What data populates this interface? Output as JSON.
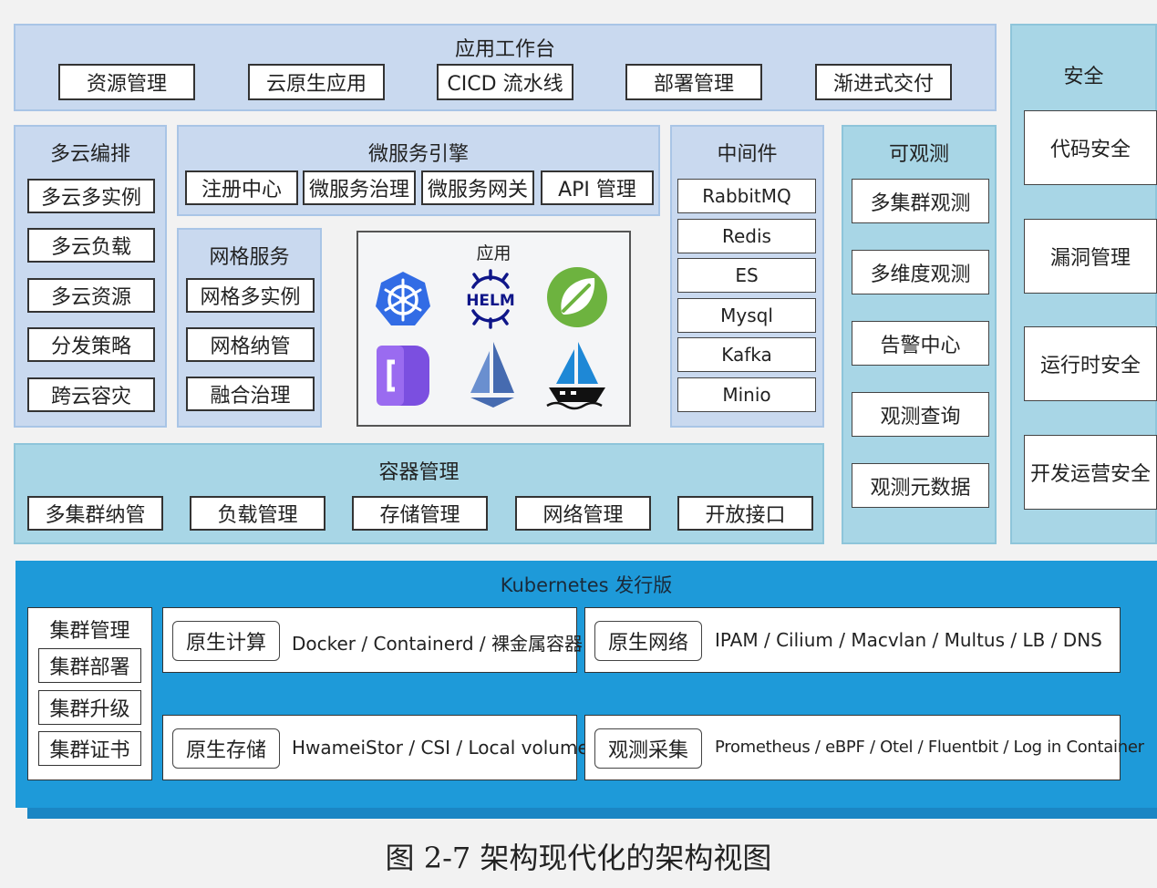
{
  "workbench": {
    "title": "应用工作台",
    "items": [
      "资源管理",
      "云原生应用",
      "CICD 流水线",
      "部署管理",
      "渐进式交付"
    ]
  },
  "security": {
    "title": "安全",
    "items": [
      "代码安全",
      "漏洞管理",
      "运行时安全",
      "开发运营安全"
    ]
  },
  "multicloud": {
    "title": "多云编排",
    "items": [
      "多云多实例",
      "多云负载",
      "多云资源",
      "分发策略",
      "跨云容灾"
    ]
  },
  "microservice": {
    "title": "微服务引擎",
    "items": [
      "注册中心",
      "微服务治理",
      "微服务网关",
      "API 管理"
    ]
  },
  "mesh": {
    "title": "网格服务",
    "items": [
      "网格多实例",
      "网格纳管",
      "融合治理"
    ]
  },
  "apps": {
    "title": "应用",
    "icons": [
      "kubernetes-icon",
      "helm-icon",
      "spring-icon",
      "dapr-icon",
      "sail-icon",
      "sailboat-icon"
    ],
    "helm_text": "HELM"
  },
  "middleware": {
    "title": "中间件",
    "items": [
      "RabbitMQ",
      "Redis",
      "ES",
      "Mysql",
      "Kafka",
      "Minio"
    ]
  },
  "observability": {
    "title": "可观测",
    "items": [
      "多集群观测",
      "多维度观测",
      "告警中心",
      "观测查询",
      "观测元数据"
    ]
  },
  "container": {
    "title": "容器管理",
    "items": [
      "多集群纳管",
      "负载管理",
      "存储管理",
      "网络管理",
      "开放接口"
    ]
  },
  "kubernetes": {
    "title": "Kubernetes 发行版",
    "cluster": {
      "title": "集群管理",
      "items": [
        "集群部署",
        "集群升级",
        "集群证书"
      ]
    },
    "compute": {
      "label": "原生计算",
      "desc": "Docker / Containerd / 裸金属容器"
    },
    "network": {
      "label": "原生网络",
      "desc": "IPAM / Cilium / Macvlan / Multus / LB / DNS"
    },
    "storage": {
      "label": "原生存储",
      "desc": "HwameiStor / CSI / Local volume"
    },
    "observe": {
      "label": "观测采集",
      "desc": "Prometheus / eBPF / Otel / Fluentbit / Log in Container"
    }
  },
  "caption": "图 2-7 架构现代化的架构视图",
  "colors": {
    "panel_light": "#c9d9ef",
    "panel_teal": "#a8d6e6",
    "kubernetes_blue": "#1e9ad9"
  }
}
